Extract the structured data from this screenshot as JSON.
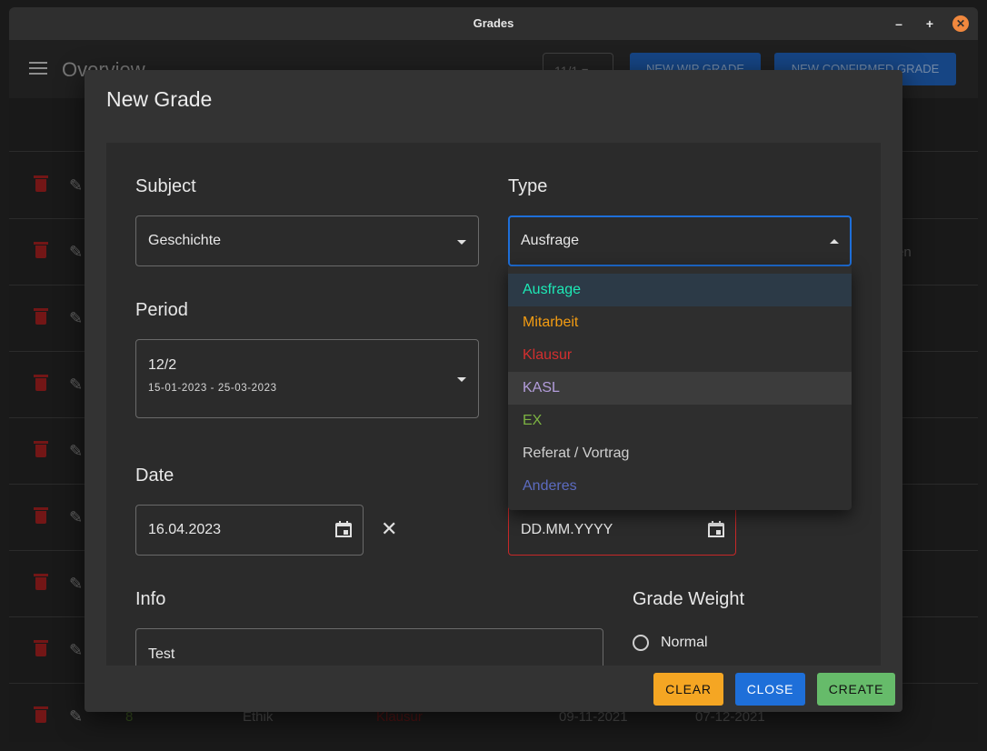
{
  "window": {
    "title": "Grades",
    "min_symbol": "–",
    "max_symbol": "+",
    "close_symbol": "✕"
  },
  "appbar": {
    "title": "Overview",
    "period_value": "11/1",
    "wip_button": "NEW WIP GRADE",
    "confirmed_button": "NEW CONFIRMED GRADE"
  },
  "background_rows": {
    "row2_right": "en",
    "last_row": {
      "grade": "8",
      "subject": "Ethik",
      "type": "Klausur",
      "date": "09-11-2021",
      "date2": "07-12-2021"
    }
  },
  "dialog": {
    "title": "New Grade",
    "subject": {
      "label": "Subject",
      "value": "Geschichte"
    },
    "type": {
      "label": "Type",
      "value": "Ausfrage"
    },
    "period": {
      "label": "Period",
      "value": "12/2",
      "range": "15-01-2023 - 25-03-2023"
    },
    "date": {
      "label": "Date",
      "value": "16.04.2023"
    },
    "date2": {
      "placeholder": "DD.MM.YYYY"
    },
    "info": {
      "label": "Info",
      "value": "Test"
    },
    "grade_weight": {
      "label": "Grade Weight",
      "option": "Normal"
    },
    "type_options": [
      {
        "label": "Ausfrage",
        "color": "#1de9b6"
      },
      {
        "label": "Mitarbeit",
        "color": "#f39c12"
      },
      {
        "label": "Klausur",
        "color": "#d32f2f"
      },
      {
        "label": "KASL",
        "color": "#b39ddb"
      },
      {
        "label": "EX",
        "color": "#7cb342"
      },
      {
        "label": "Referat / Vortrag",
        "color": "#d0d0d0"
      },
      {
        "label": "Anderes",
        "color": "#5c6bc0"
      }
    ],
    "buttons": {
      "clear": "CLEAR",
      "close": "CLOSE",
      "create": "CREATE"
    }
  }
}
